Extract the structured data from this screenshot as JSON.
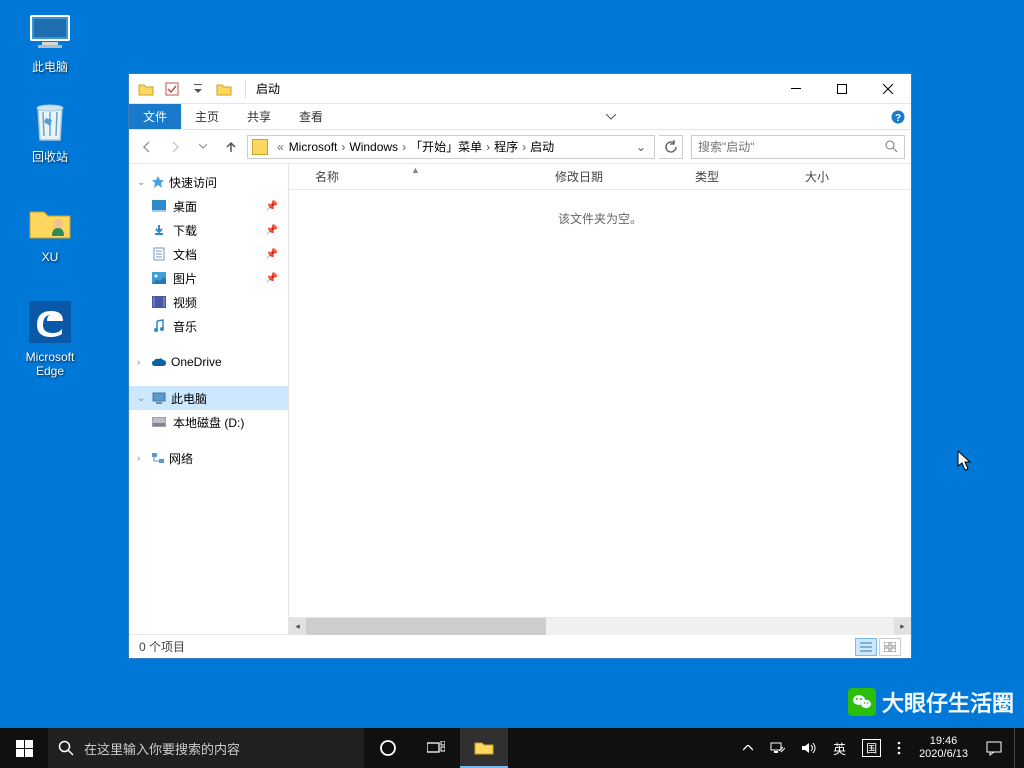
{
  "desktop": {
    "icons": [
      {
        "label": "此电脑"
      },
      {
        "label": "回收站"
      },
      {
        "label": "XU"
      },
      {
        "label": "Microsoft\nEdge"
      }
    ]
  },
  "watermark": {
    "text": "大眼仔生活圈"
  },
  "window": {
    "title": "启动",
    "ribbon": {
      "file": "文件",
      "home": "主页",
      "share": "共享",
      "view": "查看"
    },
    "breadcrumb": {
      "prefix": "«",
      "items": [
        "Microsoft",
        "Windows",
        "「开始」菜单",
        "程序",
        "启动"
      ]
    },
    "search_placeholder": "搜索\"启动\"",
    "nav": {
      "quick_access": "快速访问",
      "desktop": "桌面",
      "downloads": "下载",
      "documents": "文档",
      "pictures": "图片",
      "videos": "视频",
      "music": "音乐",
      "onedrive": "OneDrive",
      "this_pc": "此电脑",
      "drive_d": "本地磁盘 (D:)",
      "network": "网络"
    },
    "columns": {
      "name": "名称",
      "modified": "修改日期",
      "type": "类型",
      "size": "大小"
    },
    "empty_text": "该文件夹为空。",
    "status": "0 个项目"
  },
  "taskbar": {
    "search_placeholder": "在这里输入你要搜索的内容",
    "ime_lang": "英",
    "ime_mode": "国",
    "time": "19:46",
    "date": "2020/6/13"
  }
}
